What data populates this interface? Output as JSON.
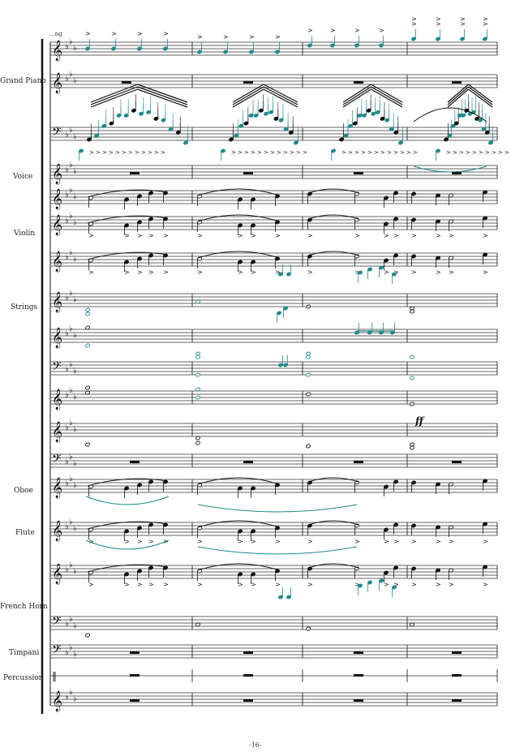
{
  "page": {
    "number_text": "-16-",
    "tempo_text": "...ng"
  },
  "instruments": [
    {
      "id": "grand-piano",
      "label": "Grand Piano"
    },
    {
      "id": "voice",
      "label": "Voice"
    },
    {
      "id": "violin",
      "label": "Violin"
    },
    {
      "id": "strings",
      "label": "Strings"
    },
    {
      "id": "oboe",
      "label": "Oboe"
    },
    {
      "id": "flute",
      "label": "Flute"
    },
    {
      "id": "french-horn",
      "label": "French Horn"
    },
    {
      "id": "timpani",
      "label": "Timpani"
    },
    {
      "id": "percussion",
      "label": "Percussion"
    }
  ],
  "dynamics": {
    "strings_ff": "ff"
  },
  "key_signature": "E-flat major (3 flats)",
  "colors": {
    "ink": "#111111",
    "accent_teal": "#1f8a8a",
    "staff_line": "#333333"
  }
}
